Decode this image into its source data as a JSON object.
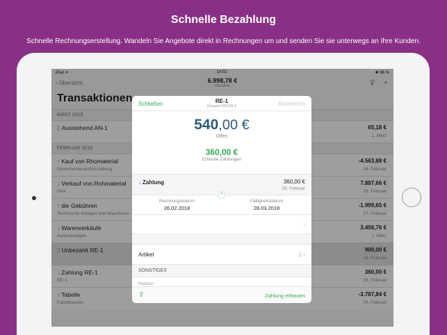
{
  "promo": {
    "headline": "Schnelle Bezahlung",
    "subline": "Schnelle Rechnungserstellung. Wandeln Sie Angebote direkt in Rechnungen um und senden Sie sie unterwegs an Ihre Kunden."
  },
  "status": {
    "left": "iPad ✈",
    "time": "14:02",
    "battery": "✱ 96 %"
  },
  "nav": {
    "back": "‹ Übersicht",
    "total": "6.998,78 €",
    "total_label": "Gesamt",
    "filter_icon": "filter-icon",
    "add_icon": "plus-icon"
  },
  "list": {
    "title": "Transaktionen",
    "sections": [
      {
        "label": "MÄRZ 2018"
      },
      {
        "label": "FEBRUAR 2018"
      }
    ],
    "rows": [
      {
        "icon": "doc",
        "title": "Ausstehend AN-1",
        "sub": "",
        "amount": "65,18 €",
        "date": "1. März"
      },
      {
        "icon": "up",
        "title": "Kauf von Rhomaterial",
        "sub": "Gewerbesteuerrückstellung",
        "amount": "-4.563,88 €",
        "date": "26. Februar"
      },
      {
        "icon": "down",
        "title": "Verkauf von Rohmaterial",
        "sub": "Pkw",
        "amount": "7.887,66 €",
        "date": "26. Februar"
      },
      {
        "icon": "up",
        "title": "die Gebühren",
        "sub": "Technische Anlagen und Maschinen",
        "amount": "-1.999,65 €",
        "date": "27. Februar"
      },
      {
        "icon": "down",
        "title": "Warenverkäufe",
        "sub": "Außenanlagen",
        "amount": "3.456,76 €",
        "date": "1. März"
      },
      {
        "icon": "doc",
        "title": "Unbezahlt RE-1",
        "sub": "",
        "amount": "900,00 €",
        "date": "26. Februar"
      },
      {
        "icon": "down",
        "title": "Zahlung RE-1",
        "sub": "RE-1",
        "amount": "360,00 €",
        "date": "26. Februar"
      },
      {
        "icon": "up",
        "title": "Tabelle",
        "sub": "Fabrikbauten",
        "amount": "-3.787,84 €",
        "date": "26. Februar"
      }
    ]
  },
  "modal": {
    "close": "Schließen",
    "title": "RE-1",
    "subtitle": "Gesamt 900,00 €",
    "edit": "Bearbeiten",
    "open_int": "540",
    "open_dec": ",00 €",
    "open_label": "Offen",
    "paid_int": "360",
    "paid_dec": ",00 €",
    "paid_label": "Erfasste Zahlungen",
    "payment_label": "Zahlung",
    "payment_amount": "360,00 €",
    "payment_date": "26. Februar",
    "invoice_date_label": "Rechnungsdatum",
    "invoice_date": "26.02.2018",
    "due_date_label": "Fälligkeitsdatum",
    "due_date": "28.03.2018",
    "articles_label": "Artikel",
    "articles_count": "1",
    "other_label": "SONSTIGES",
    "notes_placeholder": "Notizen",
    "capture": "Zahlung erfassen"
  }
}
